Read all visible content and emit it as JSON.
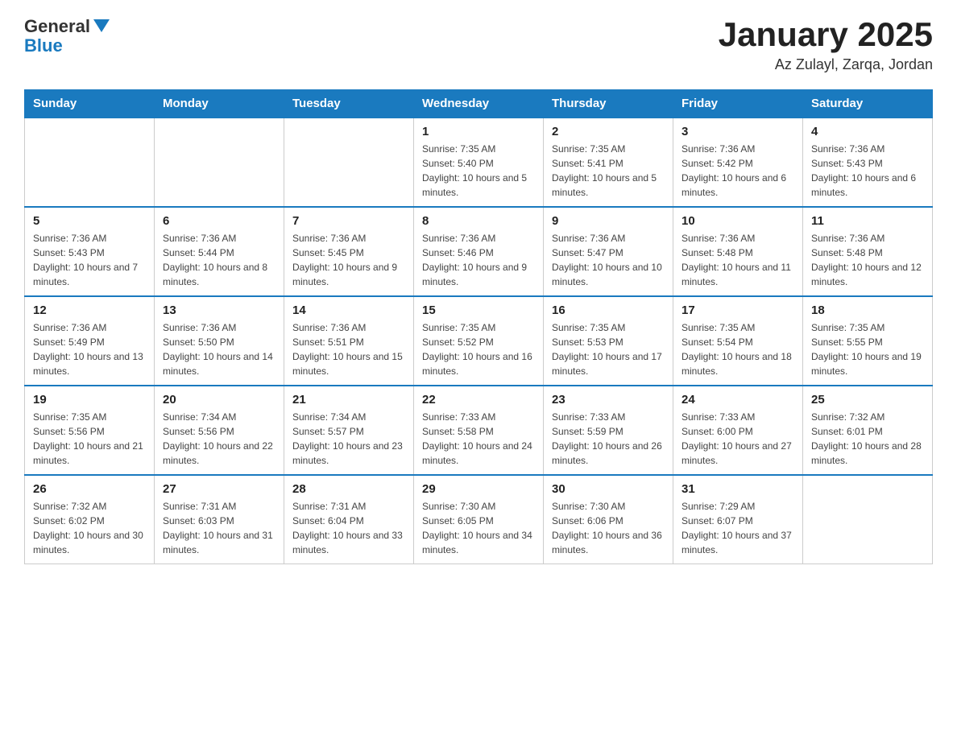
{
  "header": {
    "logo": {
      "text_general": "General",
      "text_blue": "Blue"
    },
    "title": "January 2025",
    "location": "Az Zulayl, Zarqa, Jordan"
  },
  "days_of_week": [
    "Sunday",
    "Monday",
    "Tuesday",
    "Wednesday",
    "Thursday",
    "Friday",
    "Saturday"
  ],
  "weeks": [
    [
      {
        "day": "",
        "sunrise": "",
        "sunset": "",
        "daylight": ""
      },
      {
        "day": "",
        "sunrise": "",
        "sunset": "",
        "daylight": ""
      },
      {
        "day": "",
        "sunrise": "",
        "sunset": "",
        "daylight": ""
      },
      {
        "day": "1",
        "sunrise": "Sunrise: 7:35 AM",
        "sunset": "Sunset: 5:40 PM",
        "daylight": "Daylight: 10 hours and 5 minutes."
      },
      {
        "day": "2",
        "sunrise": "Sunrise: 7:35 AM",
        "sunset": "Sunset: 5:41 PM",
        "daylight": "Daylight: 10 hours and 5 minutes."
      },
      {
        "day": "3",
        "sunrise": "Sunrise: 7:36 AM",
        "sunset": "Sunset: 5:42 PM",
        "daylight": "Daylight: 10 hours and 6 minutes."
      },
      {
        "day": "4",
        "sunrise": "Sunrise: 7:36 AM",
        "sunset": "Sunset: 5:43 PM",
        "daylight": "Daylight: 10 hours and 6 minutes."
      }
    ],
    [
      {
        "day": "5",
        "sunrise": "Sunrise: 7:36 AM",
        "sunset": "Sunset: 5:43 PM",
        "daylight": "Daylight: 10 hours and 7 minutes."
      },
      {
        "day": "6",
        "sunrise": "Sunrise: 7:36 AM",
        "sunset": "Sunset: 5:44 PM",
        "daylight": "Daylight: 10 hours and 8 minutes."
      },
      {
        "day": "7",
        "sunrise": "Sunrise: 7:36 AM",
        "sunset": "Sunset: 5:45 PM",
        "daylight": "Daylight: 10 hours and 9 minutes."
      },
      {
        "day": "8",
        "sunrise": "Sunrise: 7:36 AM",
        "sunset": "Sunset: 5:46 PM",
        "daylight": "Daylight: 10 hours and 9 minutes."
      },
      {
        "day": "9",
        "sunrise": "Sunrise: 7:36 AM",
        "sunset": "Sunset: 5:47 PM",
        "daylight": "Daylight: 10 hours and 10 minutes."
      },
      {
        "day": "10",
        "sunrise": "Sunrise: 7:36 AM",
        "sunset": "Sunset: 5:48 PM",
        "daylight": "Daylight: 10 hours and 11 minutes."
      },
      {
        "day": "11",
        "sunrise": "Sunrise: 7:36 AM",
        "sunset": "Sunset: 5:48 PM",
        "daylight": "Daylight: 10 hours and 12 minutes."
      }
    ],
    [
      {
        "day": "12",
        "sunrise": "Sunrise: 7:36 AM",
        "sunset": "Sunset: 5:49 PM",
        "daylight": "Daylight: 10 hours and 13 minutes."
      },
      {
        "day": "13",
        "sunrise": "Sunrise: 7:36 AM",
        "sunset": "Sunset: 5:50 PM",
        "daylight": "Daylight: 10 hours and 14 minutes."
      },
      {
        "day": "14",
        "sunrise": "Sunrise: 7:36 AM",
        "sunset": "Sunset: 5:51 PM",
        "daylight": "Daylight: 10 hours and 15 minutes."
      },
      {
        "day": "15",
        "sunrise": "Sunrise: 7:35 AM",
        "sunset": "Sunset: 5:52 PM",
        "daylight": "Daylight: 10 hours and 16 minutes."
      },
      {
        "day": "16",
        "sunrise": "Sunrise: 7:35 AM",
        "sunset": "Sunset: 5:53 PM",
        "daylight": "Daylight: 10 hours and 17 minutes."
      },
      {
        "day": "17",
        "sunrise": "Sunrise: 7:35 AM",
        "sunset": "Sunset: 5:54 PM",
        "daylight": "Daylight: 10 hours and 18 minutes."
      },
      {
        "day": "18",
        "sunrise": "Sunrise: 7:35 AM",
        "sunset": "Sunset: 5:55 PM",
        "daylight": "Daylight: 10 hours and 19 minutes."
      }
    ],
    [
      {
        "day": "19",
        "sunrise": "Sunrise: 7:35 AM",
        "sunset": "Sunset: 5:56 PM",
        "daylight": "Daylight: 10 hours and 21 minutes."
      },
      {
        "day": "20",
        "sunrise": "Sunrise: 7:34 AM",
        "sunset": "Sunset: 5:56 PM",
        "daylight": "Daylight: 10 hours and 22 minutes."
      },
      {
        "day": "21",
        "sunrise": "Sunrise: 7:34 AM",
        "sunset": "Sunset: 5:57 PM",
        "daylight": "Daylight: 10 hours and 23 minutes."
      },
      {
        "day": "22",
        "sunrise": "Sunrise: 7:33 AM",
        "sunset": "Sunset: 5:58 PM",
        "daylight": "Daylight: 10 hours and 24 minutes."
      },
      {
        "day": "23",
        "sunrise": "Sunrise: 7:33 AM",
        "sunset": "Sunset: 5:59 PM",
        "daylight": "Daylight: 10 hours and 26 minutes."
      },
      {
        "day": "24",
        "sunrise": "Sunrise: 7:33 AM",
        "sunset": "Sunset: 6:00 PM",
        "daylight": "Daylight: 10 hours and 27 minutes."
      },
      {
        "day": "25",
        "sunrise": "Sunrise: 7:32 AM",
        "sunset": "Sunset: 6:01 PM",
        "daylight": "Daylight: 10 hours and 28 minutes."
      }
    ],
    [
      {
        "day": "26",
        "sunrise": "Sunrise: 7:32 AM",
        "sunset": "Sunset: 6:02 PM",
        "daylight": "Daylight: 10 hours and 30 minutes."
      },
      {
        "day": "27",
        "sunrise": "Sunrise: 7:31 AM",
        "sunset": "Sunset: 6:03 PM",
        "daylight": "Daylight: 10 hours and 31 minutes."
      },
      {
        "day": "28",
        "sunrise": "Sunrise: 7:31 AM",
        "sunset": "Sunset: 6:04 PM",
        "daylight": "Daylight: 10 hours and 33 minutes."
      },
      {
        "day": "29",
        "sunrise": "Sunrise: 7:30 AM",
        "sunset": "Sunset: 6:05 PM",
        "daylight": "Daylight: 10 hours and 34 minutes."
      },
      {
        "day": "30",
        "sunrise": "Sunrise: 7:30 AM",
        "sunset": "Sunset: 6:06 PM",
        "daylight": "Daylight: 10 hours and 36 minutes."
      },
      {
        "day": "31",
        "sunrise": "Sunrise: 7:29 AM",
        "sunset": "Sunset: 6:07 PM",
        "daylight": "Daylight: 10 hours and 37 minutes."
      },
      {
        "day": "",
        "sunrise": "",
        "sunset": "",
        "daylight": ""
      }
    ]
  ]
}
